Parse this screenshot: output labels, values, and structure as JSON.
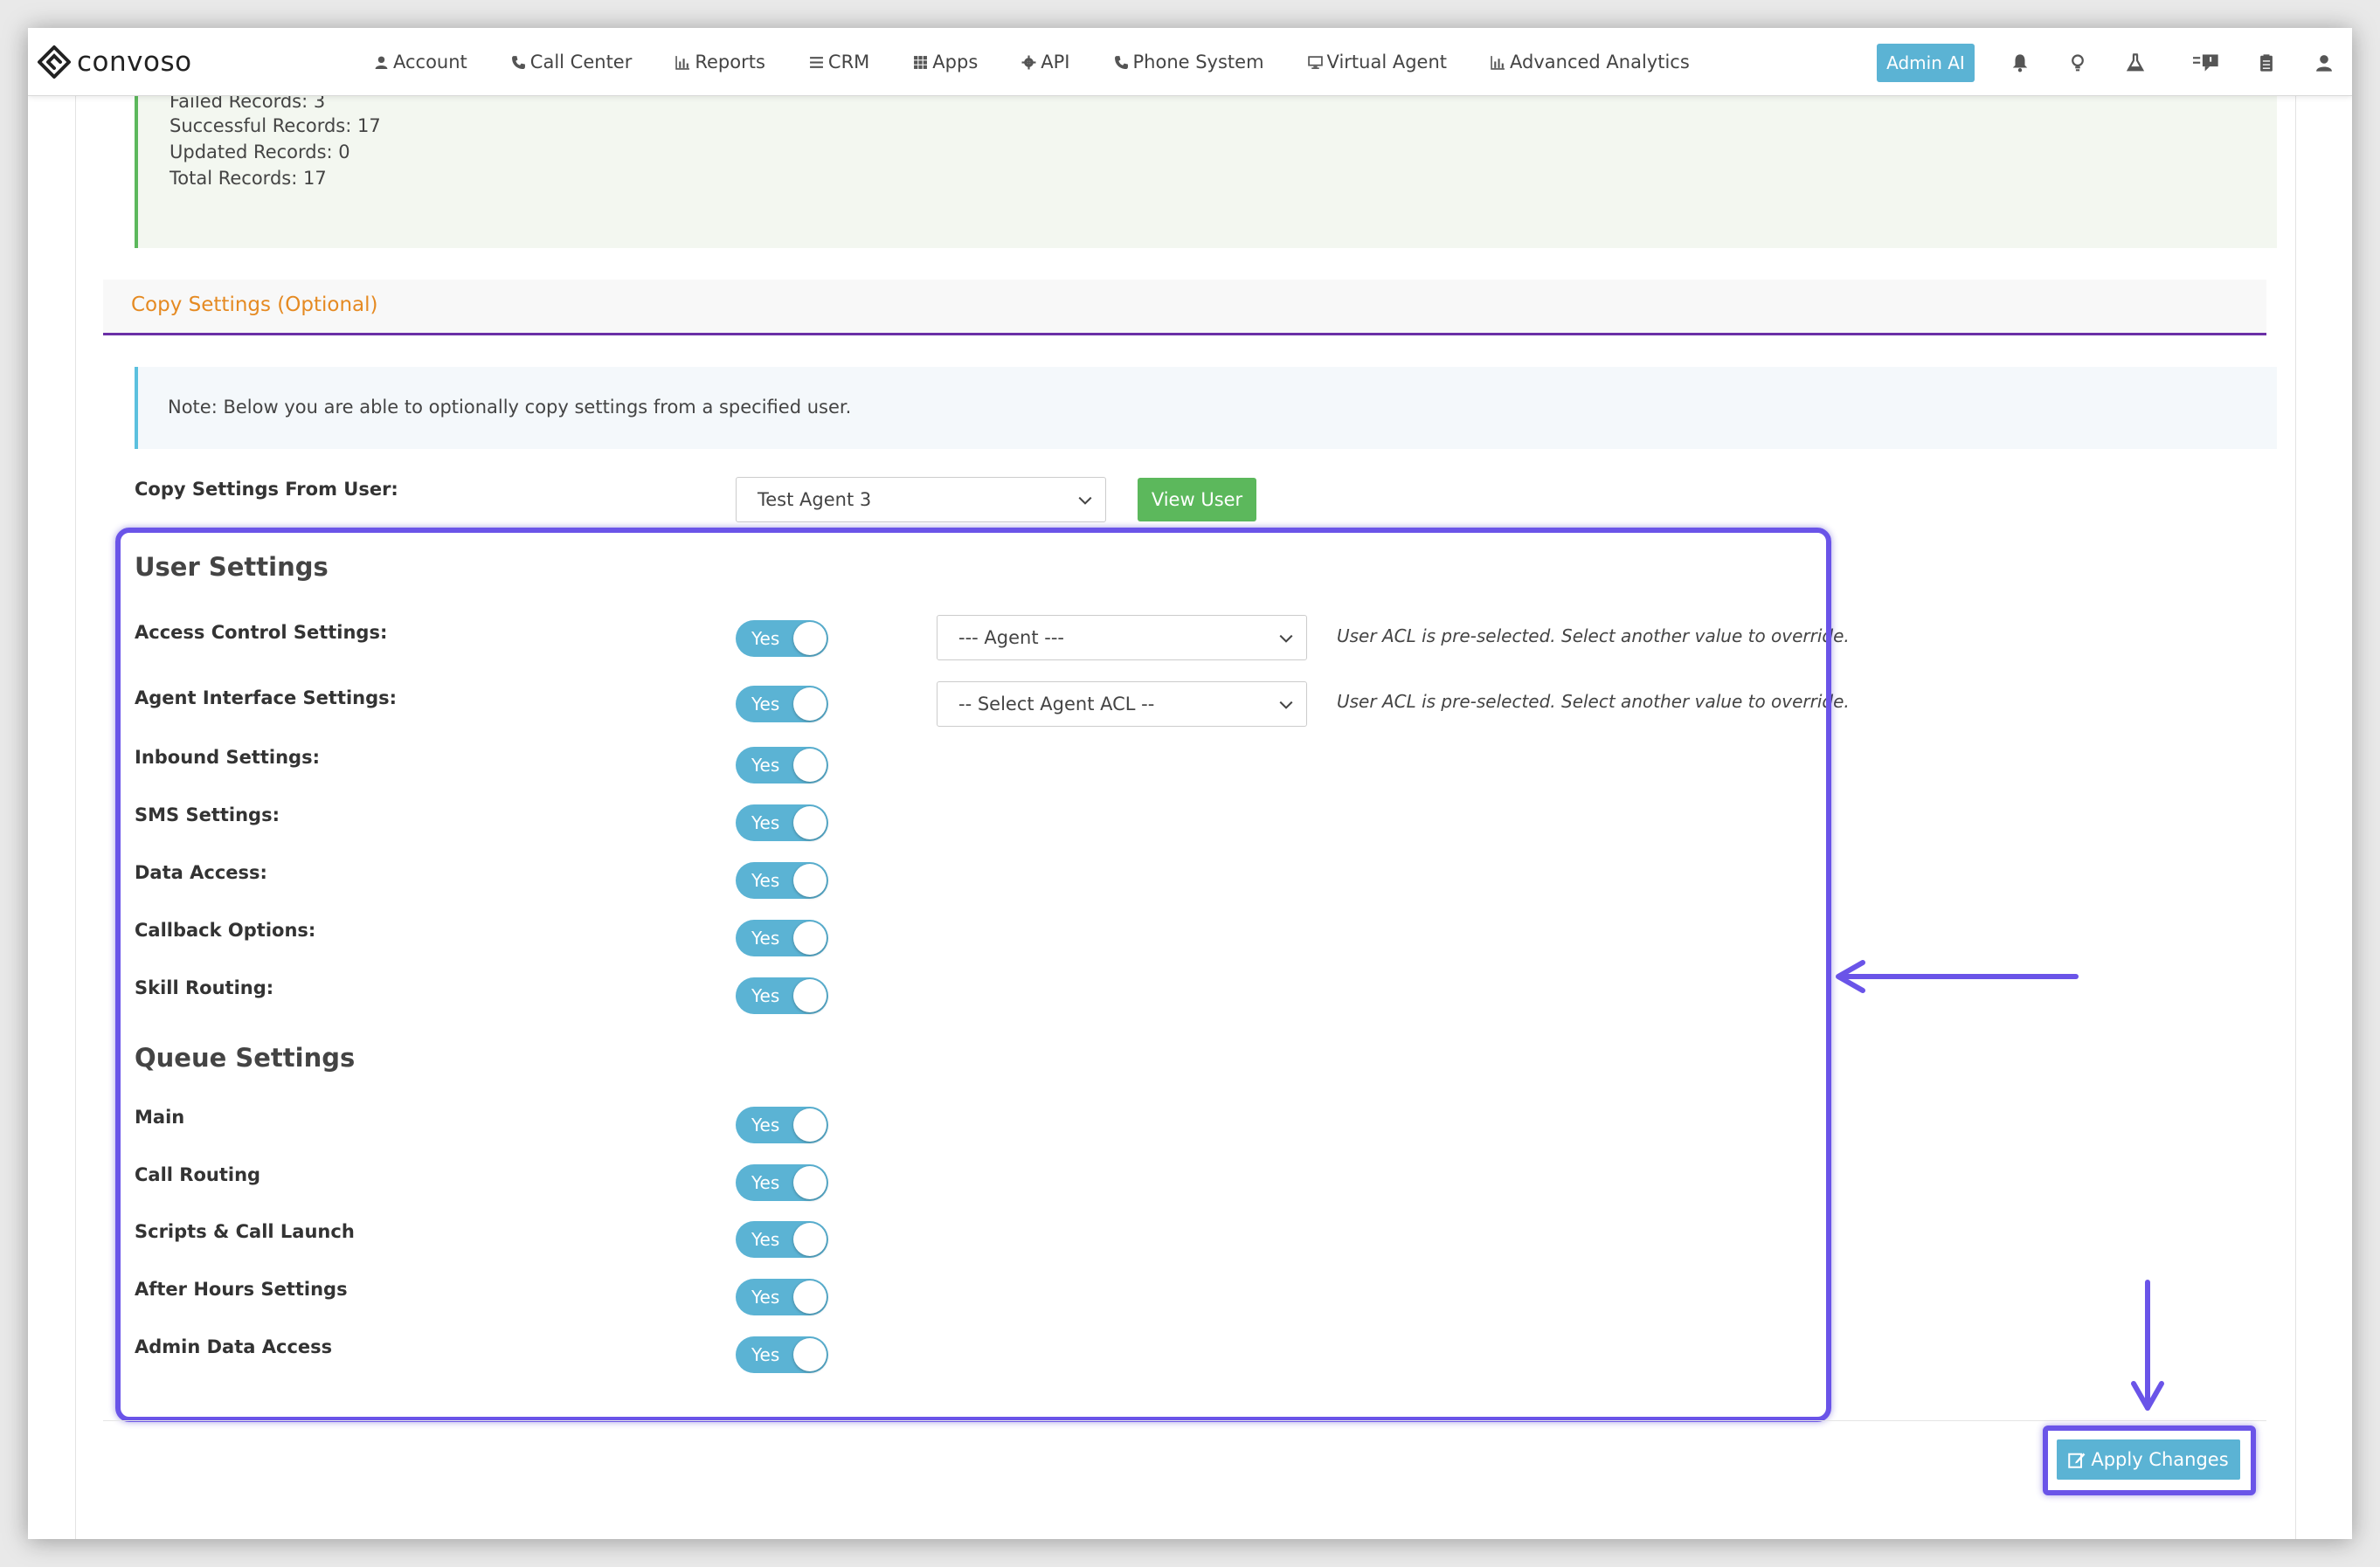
{
  "nav": {
    "logo": "convoso",
    "items": [
      {
        "label": "Account",
        "icon": "user-icon"
      },
      {
        "label": "Call Center",
        "icon": "phone-icon"
      },
      {
        "label": "Reports",
        "icon": "bar-chart-icon"
      },
      {
        "label": "CRM",
        "icon": "list-icon"
      },
      {
        "label": "Apps",
        "icon": "grid-icon"
      },
      {
        "label": "API",
        "icon": "gear-icon"
      },
      {
        "label": "Phone System",
        "icon": "phone-icon"
      },
      {
        "label": "Virtual Agent",
        "icon": "monitor-icon"
      },
      {
        "label": "Advanced Analytics",
        "icon": "bar-chart-icon"
      }
    ],
    "admin_button": "Admin AI",
    "right_icons": [
      "bell-icon",
      "lightbulb-icon",
      "flask-icon",
      "messages-icon",
      "clipboard-icon",
      "user-icon"
    ]
  },
  "results": {
    "failed": "Failed Records: 3",
    "successful": "Successful Records: 17",
    "updated": "Updated Records: 0",
    "total": "Total Records: 17"
  },
  "copy_settings": {
    "section_title": "Copy Settings (Optional)",
    "note": "Note: Below you are able to optionally copy settings from a specified user.",
    "from_label": "Copy Settings From User:",
    "from_value": "Test Agent 3",
    "view_user": "View User"
  },
  "user_settings": {
    "heading": "User Settings",
    "rows": [
      {
        "label": "Access Control Settings:",
        "toggle": "Yes",
        "select": "--- Agent ---",
        "hint": "User ACL is pre-selected. Select another value to override."
      },
      {
        "label": "Agent Interface Settings:",
        "toggle": "Yes",
        "select": "-- Select Agent ACL --",
        "hint": "User ACL is pre-selected. Select another value to override."
      },
      {
        "label": "Inbound Settings:",
        "toggle": "Yes"
      },
      {
        "label": "SMS Settings:",
        "toggle": "Yes"
      },
      {
        "label": "Data Access:",
        "toggle": "Yes"
      },
      {
        "label": "Callback Options:",
        "toggle": "Yes"
      },
      {
        "label": "Skill Routing:",
        "toggle": "Yes"
      }
    ]
  },
  "queue_settings": {
    "heading": "Queue Settings",
    "rows": [
      {
        "label": "Main",
        "toggle": "Yes"
      },
      {
        "label": "Call Routing",
        "toggle": "Yes"
      },
      {
        "label": "Scripts & Call Launch",
        "toggle": "Yes"
      },
      {
        "label": "After Hours Settings",
        "toggle": "Yes"
      },
      {
        "label": "Admin Data Access",
        "toggle": "Yes"
      }
    ]
  },
  "apply_button": "Apply Changes",
  "colors": {
    "accent": "#5bb3d4",
    "success": "#5cb85c",
    "section_title": "#e58a22",
    "section_rule": "#6b2fa7",
    "annotation": "#6a54e8"
  }
}
